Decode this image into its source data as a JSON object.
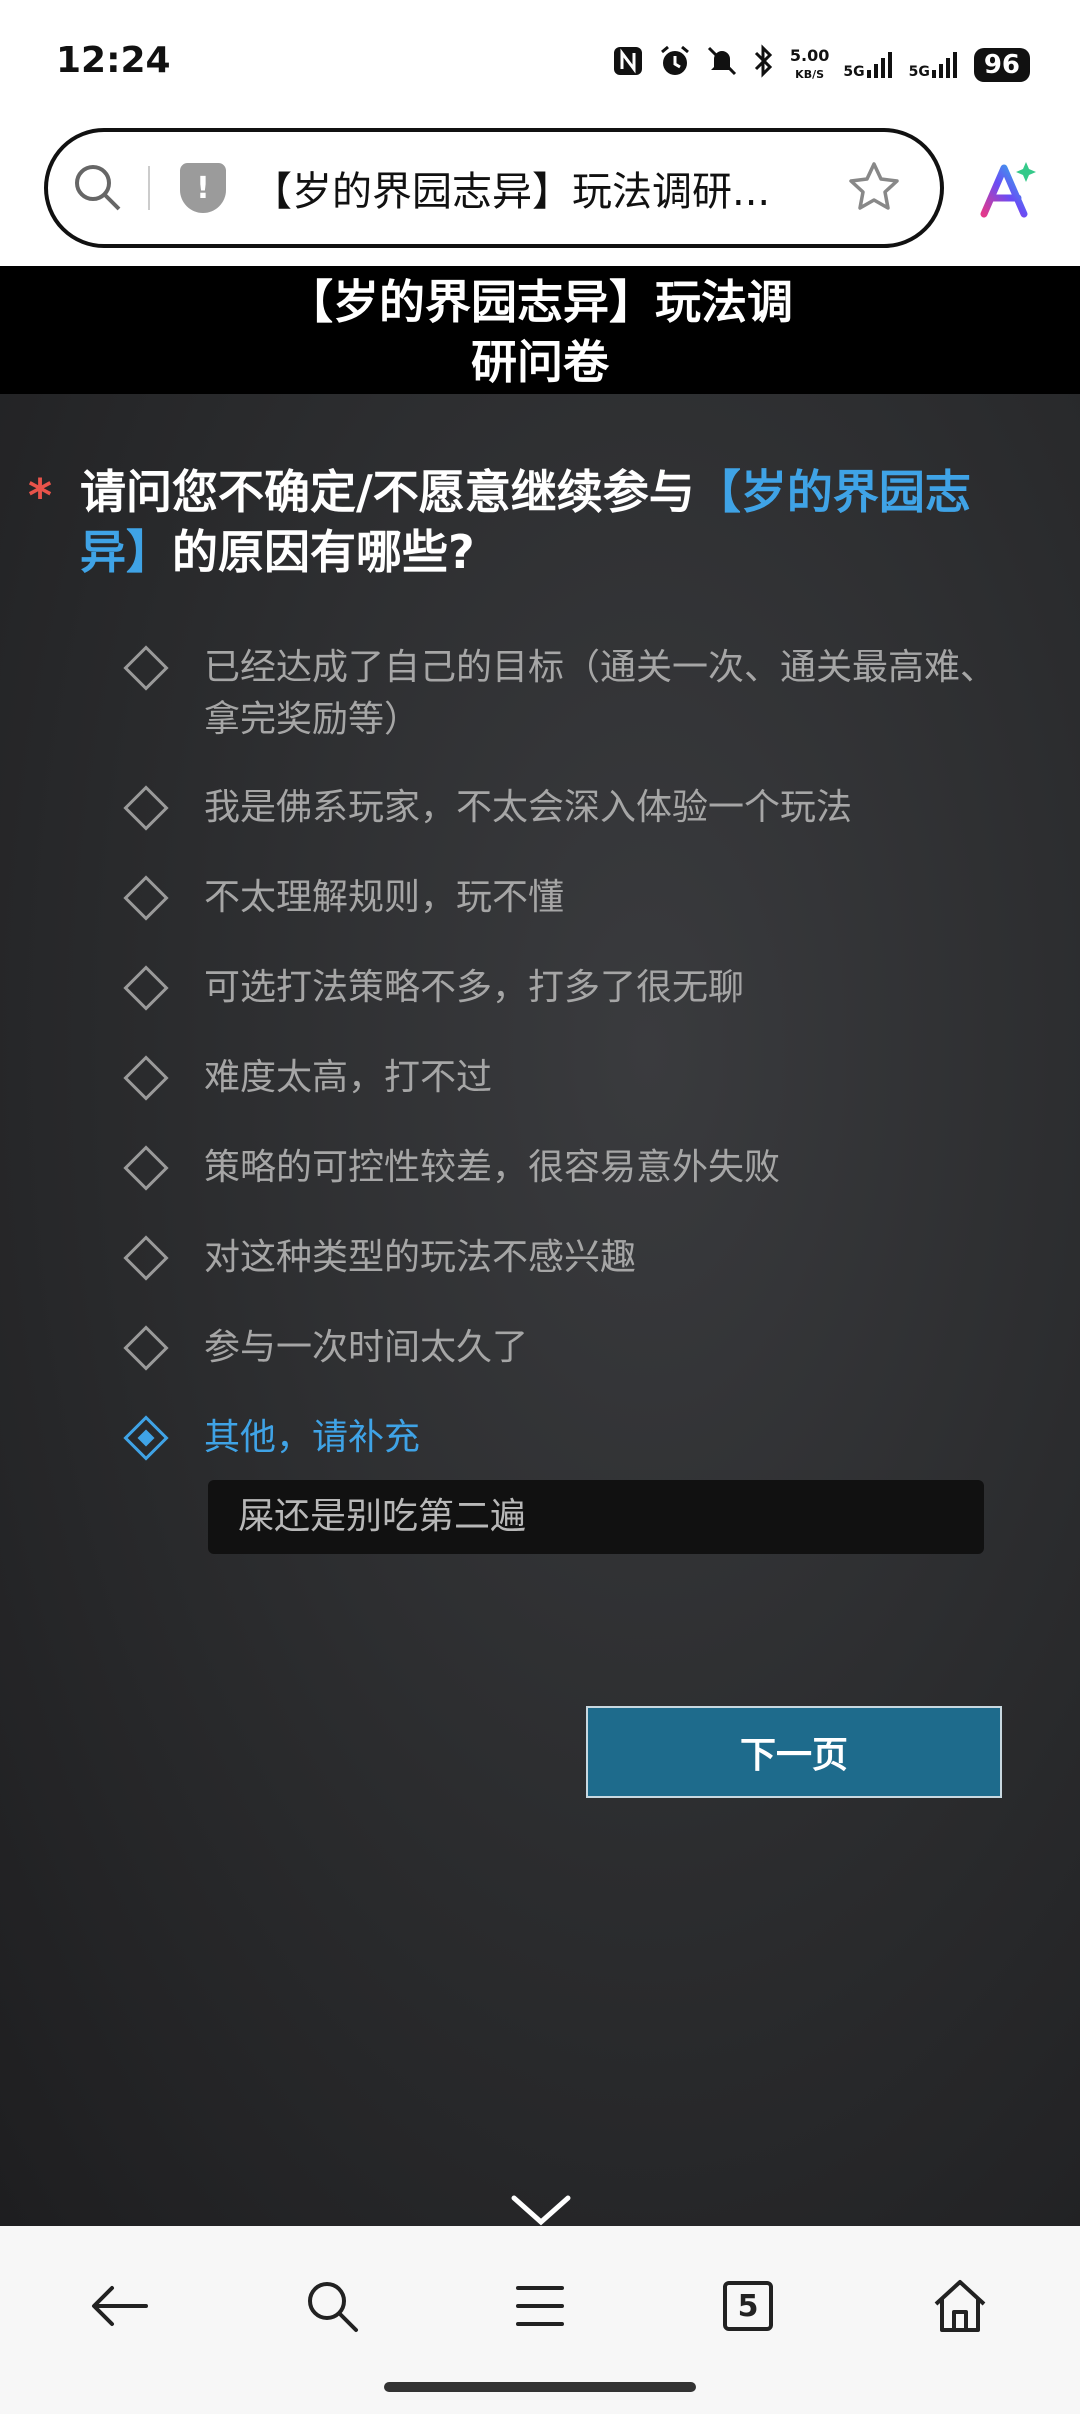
{
  "status_bar": {
    "time": "12:24",
    "net_speed": "5.00",
    "net_unit": "KB/S",
    "signal1": "5G",
    "signal2": "5G",
    "battery": "96"
  },
  "address_bar": {
    "title": "【岁的界园志异】玩法调研..."
  },
  "page": {
    "header_line1": "【岁的界园志异】玩法调",
    "header_line2": "研问卷",
    "question_star": "*",
    "question_before": "请问您不确定/不愿意继续参与",
    "question_highlight": "【岁的界园志异】",
    "question_after": "的原因有哪些?",
    "options": [
      {
        "label": "已经达成了自己的目标（通关一次、通关最高难、拿完奖励等）",
        "selected": false
      },
      {
        "label": "我是佛系玩家，不太会深入体验一个玩法",
        "selected": false
      },
      {
        "label": "不太理解规则，玩不懂",
        "selected": false
      },
      {
        "label": "可选打法策略不多，打多了很无聊",
        "selected": false
      },
      {
        "label": "难度太高，打不过",
        "selected": false
      },
      {
        "label": "策略的可控性较差，很容易意外失败",
        "selected": false
      },
      {
        "label": "对这种类型的玩法不感兴趣",
        "selected": false
      },
      {
        "label": "参与一次时间太久了",
        "selected": false
      },
      {
        "label": "其他，请补充",
        "selected": true
      }
    ],
    "other_input_value": "屎还是别吃第二遍",
    "next_button": "下一页"
  },
  "bottom_nav": {
    "tab_count": "5"
  },
  "colors": {
    "accent": "#3fa3e6",
    "required_star": "#e8534a",
    "next_button_bg": "#1e6b8c"
  }
}
